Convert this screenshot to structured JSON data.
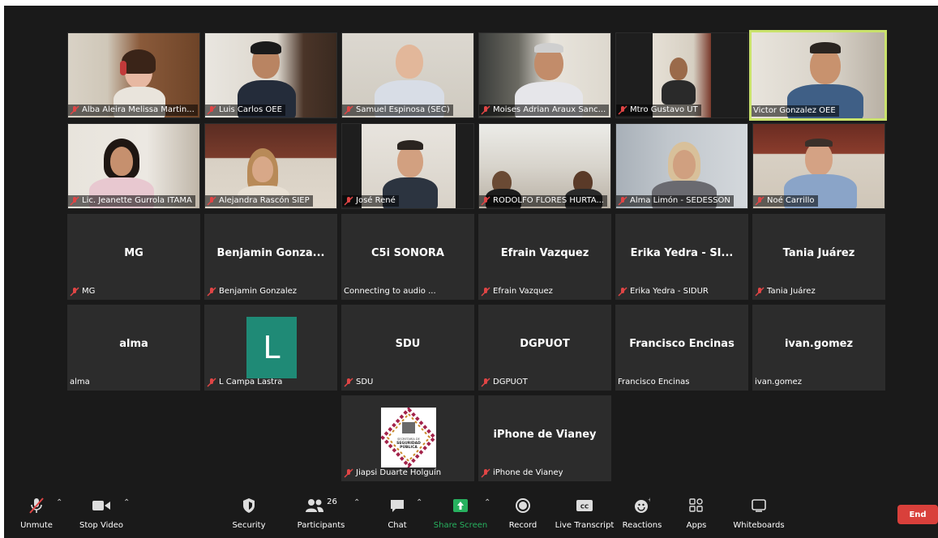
{
  "meeting": {
    "video_tiles": [
      {
        "name": "Alba Aleira Melissa Martin..."
      },
      {
        "name": "Luis Carlos OEE"
      },
      {
        "name": "Samuel Espinosa (SEC)"
      },
      {
        "name": "Moises Adrian Araux Sanc..."
      },
      {
        "name": "Mtro Gustavo UT"
      },
      {
        "name": "Victor Gonzalez  OEE"
      },
      {
        "name": "Lic. Jeanette Gurrola ITAMA"
      },
      {
        "name": "Alejandra Rascón SIEP"
      },
      {
        "name": "José René"
      },
      {
        "name": "RODOLFO FLORES HURTA..."
      },
      {
        "name": "Alma Limón - SEDESSON"
      },
      {
        "name": "Noé Carrillo"
      }
    ],
    "name_tiles": [
      {
        "display": "MG",
        "label": "MG"
      },
      {
        "display": "Benjamin  Gonza...",
        "label": "Benjamin Gonzalez"
      },
      {
        "display": "C5i SONORA",
        "label": "Connecting to audio ..."
      },
      {
        "display": "Efrain Vazquez",
        "label": "Efrain Vazquez"
      },
      {
        "display": "Erika Yedra - SI...",
        "label": "Erika Yedra - SIDUR"
      },
      {
        "display": "Tania Juárez",
        "label": "Tania Juárez"
      },
      {
        "display": "alma",
        "label": "alma"
      },
      {
        "display": "L",
        "label": "L Campa Lastra"
      },
      {
        "display": "SDU",
        "label": "SDU"
      },
      {
        "display": "DGPUOT",
        "label": "DGPUOT"
      },
      {
        "display": "Francisco Encinas",
        "label": "Francisco Encinas"
      },
      {
        "display": "ivan.gomez",
        "label": "ivan.gomez"
      },
      {
        "display": "",
        "label": "Jiapsi Duarte Holguín",
        "logo_text": [
          "SECRETARÍA DE",
          "SEGURIDAD",
          "PÚBLICA"
        ]
      },
      {
        "display": "iPhone de Vianey",
        "label": "iPhone de Vianey"
      }
    ]
  },
  "toolbar": {
    "unmute": "Unmute",
    "stop_video": "Stop Video",
    "security": "Security",
    "participants": "Participants",
    "participants_count": "26",
    "chat": "Chat",
    "share_screen": "Share Screen",
    "record": "Record",
    "live_transcript": "Live Transcript",
    "cc": "CC",
    "reactions": "Reactions",
    "apps": "Apps",
    "whiteboards": "Whiteboards",
    "end": "End"
  },
  "colors": {
    "background": "#1a1a1a",
    "tile": "#2c2c2c",
    "active_speaker_border": "#c9e26b",
    "share_screen_green": "#27b15f",
    "end_red": "#d9403b",
    "avatar_teal": "#1f8a76",
    "muted_red": "#e04545"
  }
}
